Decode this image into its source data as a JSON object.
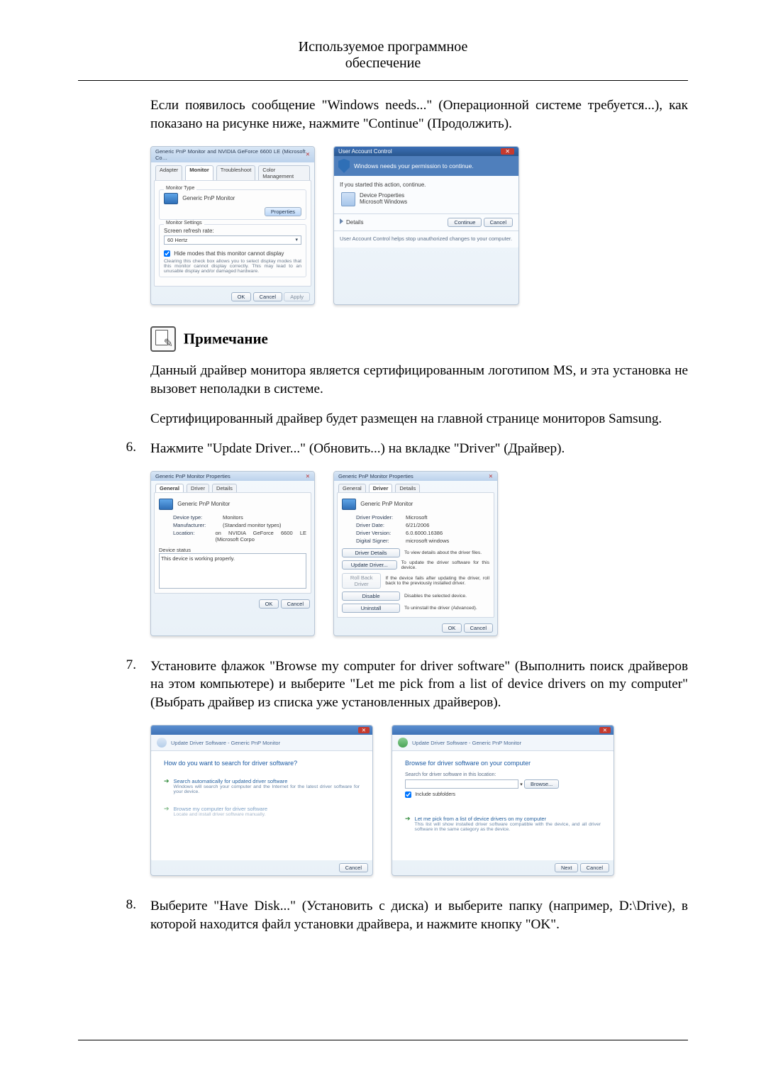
{
  "page_header": {
    "line1": "Используемое программное",
    "line2": "обеспечение"
  },
  "intro_para": "Если появилось сообщение \"Windows needs...\" (Операционной системе требуется...), как показано на рисунке ниже, нажмите \"Continue\" (Продолжить).",
  "fig1_left": {
    "title": "Generic PnP Monitor and NVIDIA GeForce 6600 LE (Microsoft Co…",
    "tabs": [
      "Adapter",
      "Monitor",
      "Troubleshoot",
      "Color Management"
    ],
    "active_tab": 1,
    "section1_legend": "Monitor Type",
    "monitor_name": "Generic PnP Monitor",
    "properties_btn": "Properties",
    "section2_legend": "Monitor Settings",
    "refresh_label": "Screen refresh rate:",
    "refresh_value": "60 Hertz",
    "checkbox_label": "Hide modes that this monitor cannot display",
    "checkbox_desc": "Clearing this check box allows you to select display modes that this monitor cannot display correctly. This may lead to an unusable display and/or damaged hardware.",
    "ok": "OK",
    "cancel": "Cancel",
    "apply": "Apply"
  },
  "fig1_right": {
    "title": "User Account Control",
    "strip": "Windows needs your permission to continue.",
    "line1": "If you started this action, continue.",
    "prog_name": "Device Properties",
    "prog_pub": "Microsoft Windows",
    "details": "Details",
    "continue": "Continue",
    "cancel": "Cancel",
    "footer": "User Account Control helps stop unauthorized changes to your computer."
  },
  "note": {
    "title": "Примечание",
    "p1": "Данный драйвер монитора является сертифицированным логотипом MS, и эта установка не вызовет неполадки в системе.",
    "p2": "Сертифицированный драйвер будет размещен на главной странице мониторов Samsung."
  },
  "step6": {
    "num": "6.",
    "text": "Нажмите \"Update Driver...\" (Обновить...) на вкладке \"Driver\" (Драйвер)."
  },
  "fig2_left": {
    "title": "Generic PnP Monitor Properties",
    "tabs": [
      "General",
      "Driver",
      "Details"
    ],
    "active_tab": 0,
    "name": "Generic PnP Monitor",
    "rows": {
      "device_type_l": "Device type:",
      "device_type_v": "Monitors",
      "manufacturer_l": "Manufacturer:",
      "manufacturer_v": "(Standard monitor types)",
      "location_l": "Location:",
      "location_v": "on NVIDIA GeForce 6600 LE (Microsoft Corpo"
    },
    "status_legend": "Device status",
    "status_text": "This device is working properly.",
    "ok": "OK",
    "cancel": "Cancel"
  },
  "fig2_right": {
    "title": "Generic PnP Monitor Properties",
    "tabs": [
      "General",
      "Driver",
      "Details"
    ],
    "active_tab": 1,
    "name": "Generic PnP Monitor",
    "rows": {
      "provider_l": "Driver Provider:",
      "provider_v": "Microsoft",
      "date_l": "Driver Date:",
      "date_v": "6/21/2006",
      "version_l": "Driver Version:",
      "version_v": "6.0.6000.16386",
      "signer_l": "Digital Signer:",
      "signer_v": "microsoft windows"
    },
    "buttons": {
      "details": "Driver Details",
      "details_desc": "To view details about the driver files.",
      "update": "Update Driver...",
      "update_desc": "To update the driver software for this device.",
      "rollback": "Roll Back Driver",
      "rollback_desc": "If the device fails after updating the driver, roll back to the previously installed driver.",
      "disable": "Disable",
      "disable_desc": "Disables the selected device.",
      "uninstall": "Uninstall",
      "uninstall_desc": "To uninstall the driver (Advanced)."
    },
    "ok": "OK",
    "cancel": "Cancel"
  },
  "step7": {
    "num": "7.",
    "text": "Установите флажок \"Browse my computer for driver software\" (Выполнить поиск драйверов на этом компьютере) и выберите \"Let me pick from a list of device drivers on my computer\" (Выбрать драйвер из списка уже установленных драйверов)."
  },
  "fig3_left": {
    "crumb": "Update Driver Software - Generic PnP Monitor",
    "heading": "How do you want to search for driver software?",
    "opt1": "Search automatically for updated driver software",
    "opt1_sub": "Windows will search your computer and the Internet for the latest driver software for your device.",
    "opt2": "Browse my computer for driver software",
    "opt2_sub": "Locate and install driver software manually.",
    "cancel": "Cancel"
  },
  "fig3_right": {
    "crumb": "Update Driver Software - Generic PnP Monitor",
    "heading": "Browse for driver software on your computer",
    "search_label": "Search for driver software in this location:",
    "browse": "Browse...",
    "include": "Include subfolders",
    "opt1": "Let me pick from a list of device drivers on my computer",
    "opt1_sub": "This list will show installed driver software compatible with the device, and all driver software in the same category as the device.",
    "next": "Next",
    "cancel": "Cancel"
  },
  "step8": {
    "num": "8.",
    "text": "Выберите \"Have Disk...\" (Установить с диска) и выберите папку (например, D:\\Drive), в которой находится файл установки драйвера, и нажмите кнопку \"OK\"."
  }
}
